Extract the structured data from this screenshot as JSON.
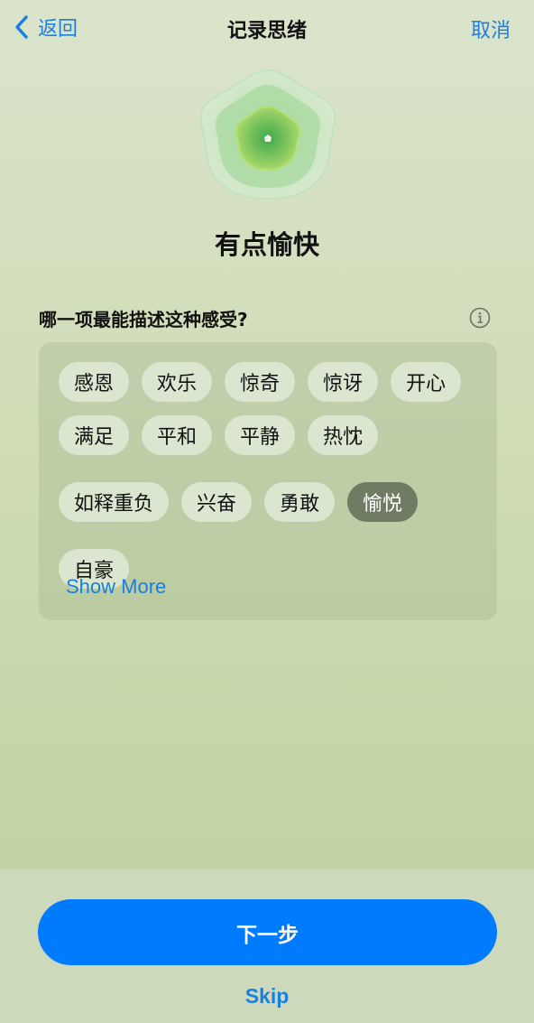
{
  "navbar": {
    "back_label": "返回",
    "title": "记录思绪",
    "cancel_label": "取消"
  },
  "mood": {
    "icon": "flower-mood-icon",
    "title": "有点愉快"
  },
  "question": {
    "text": "哪一项最能描述这种感受?",
    "info_icon": "info-circle-icon"
  },
  "emotions": {
    "chips": [
      {
        "label": "感恩",
        "selected": false
      },
      {
        "label": "欢乐",
        "selected": false
      },
      {
        "label": "惊奇",
        "selected": false
      },
      {
        "label": "惊讶",
        "selected": false
      },
      {
        "label": "开心",
        "selected": false
      },
      {
        "label": "满足",
        "selected": false
      },
      {
        "label": "平和",
        "selected": false
      },
      {
        "label": "平静",
        "selected": false
      },
      {
        "label": "热忱",
        "selected": false
      },
      {
        "label": "如释重负",
        "selected": false
      },
      {
        "label": "兴奋",
        "selected": false
      },
      {
        "label": "勇敢",
        "selected": false
      },
      {
        "label": "愉悦",
        "selected": true
      },
      {
        "label": "自豪",
        "selected": false
      }
    ],
    "show_more_label": "Show More"
  },
  "footer": {
    "next_label": "下一步",
    "skip_label": "Skip"
  },
  "colors": {
    "accent": "#007bfe",
    "link": "#1a7fe0",
    "chip_selected": "#6f7b63",
    "chip": "#dbe6d0"
  }
}
